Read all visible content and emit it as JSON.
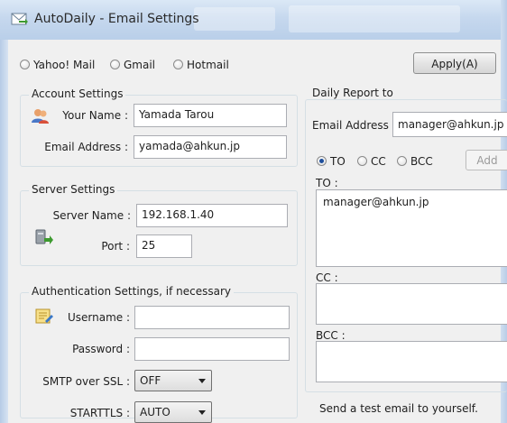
{
  "window": {
    "title": "AutoDaily - Email Settings"
  },
  "mail_providers": {
    "options": [
      "Yahoo! Mail",
      "Gmail",
      "Hotmail"
    ],
    "selected": null
  },
  "apply_button": "Apply(A)",
  "account_settings": {
    "title": "Account Settings",
    "your_name_label": "Your Name :",
    "your_name_value": "Yamada Tarou",
    "email_label": "Email Address :",
    "email_value": "yamada@ahkun.jp"
  },
  "server_settings": {
    "title": "Server Settings",
    "server_name_label": "Server Name :",
    "server_name_value": "192.168.1.40",
    "port_label": "Port :",
    "port_value": "25"
  },
  "auth_settings": {
    "title": "Authentication Settings, if necessary",
    "username_label": "Username :",
    "username_value": "",
    "password_label": "Password :",
    "password_value": "",
    "smtp_ssl_label": "SMTP over SSL :",
    "smtp_ssl_value": "OFF",
    "starttls_label": "STARTTLS :",
    "starttls_value": "AUTO"
  },
  "daily_report": {
    "title": "Daily Report to",
    "email_label": "Email Address :",
    "email_value": "manager@ahkun.jp",
    "recipient_types": [
      "TO",
      "CC",
      "BCC"
    ],
    "selected_type": "TO",
    "add_button": "Add",
    "to_label": "TO :",
    "to_value": "manager@ahkun.jp",
    "cc_label": "CC :",
    "cc_value": "",
    "bcc_label": "BCC :",
    "bcc_value": "",
    "test_email_text": "Send a test email to yourself."
  },
  "colors": {
    "title_bar": "#c6d8ee",
    "radio_selected": "#1e4f9c",
    "group_border": "#d5dfe5"
  }
}
